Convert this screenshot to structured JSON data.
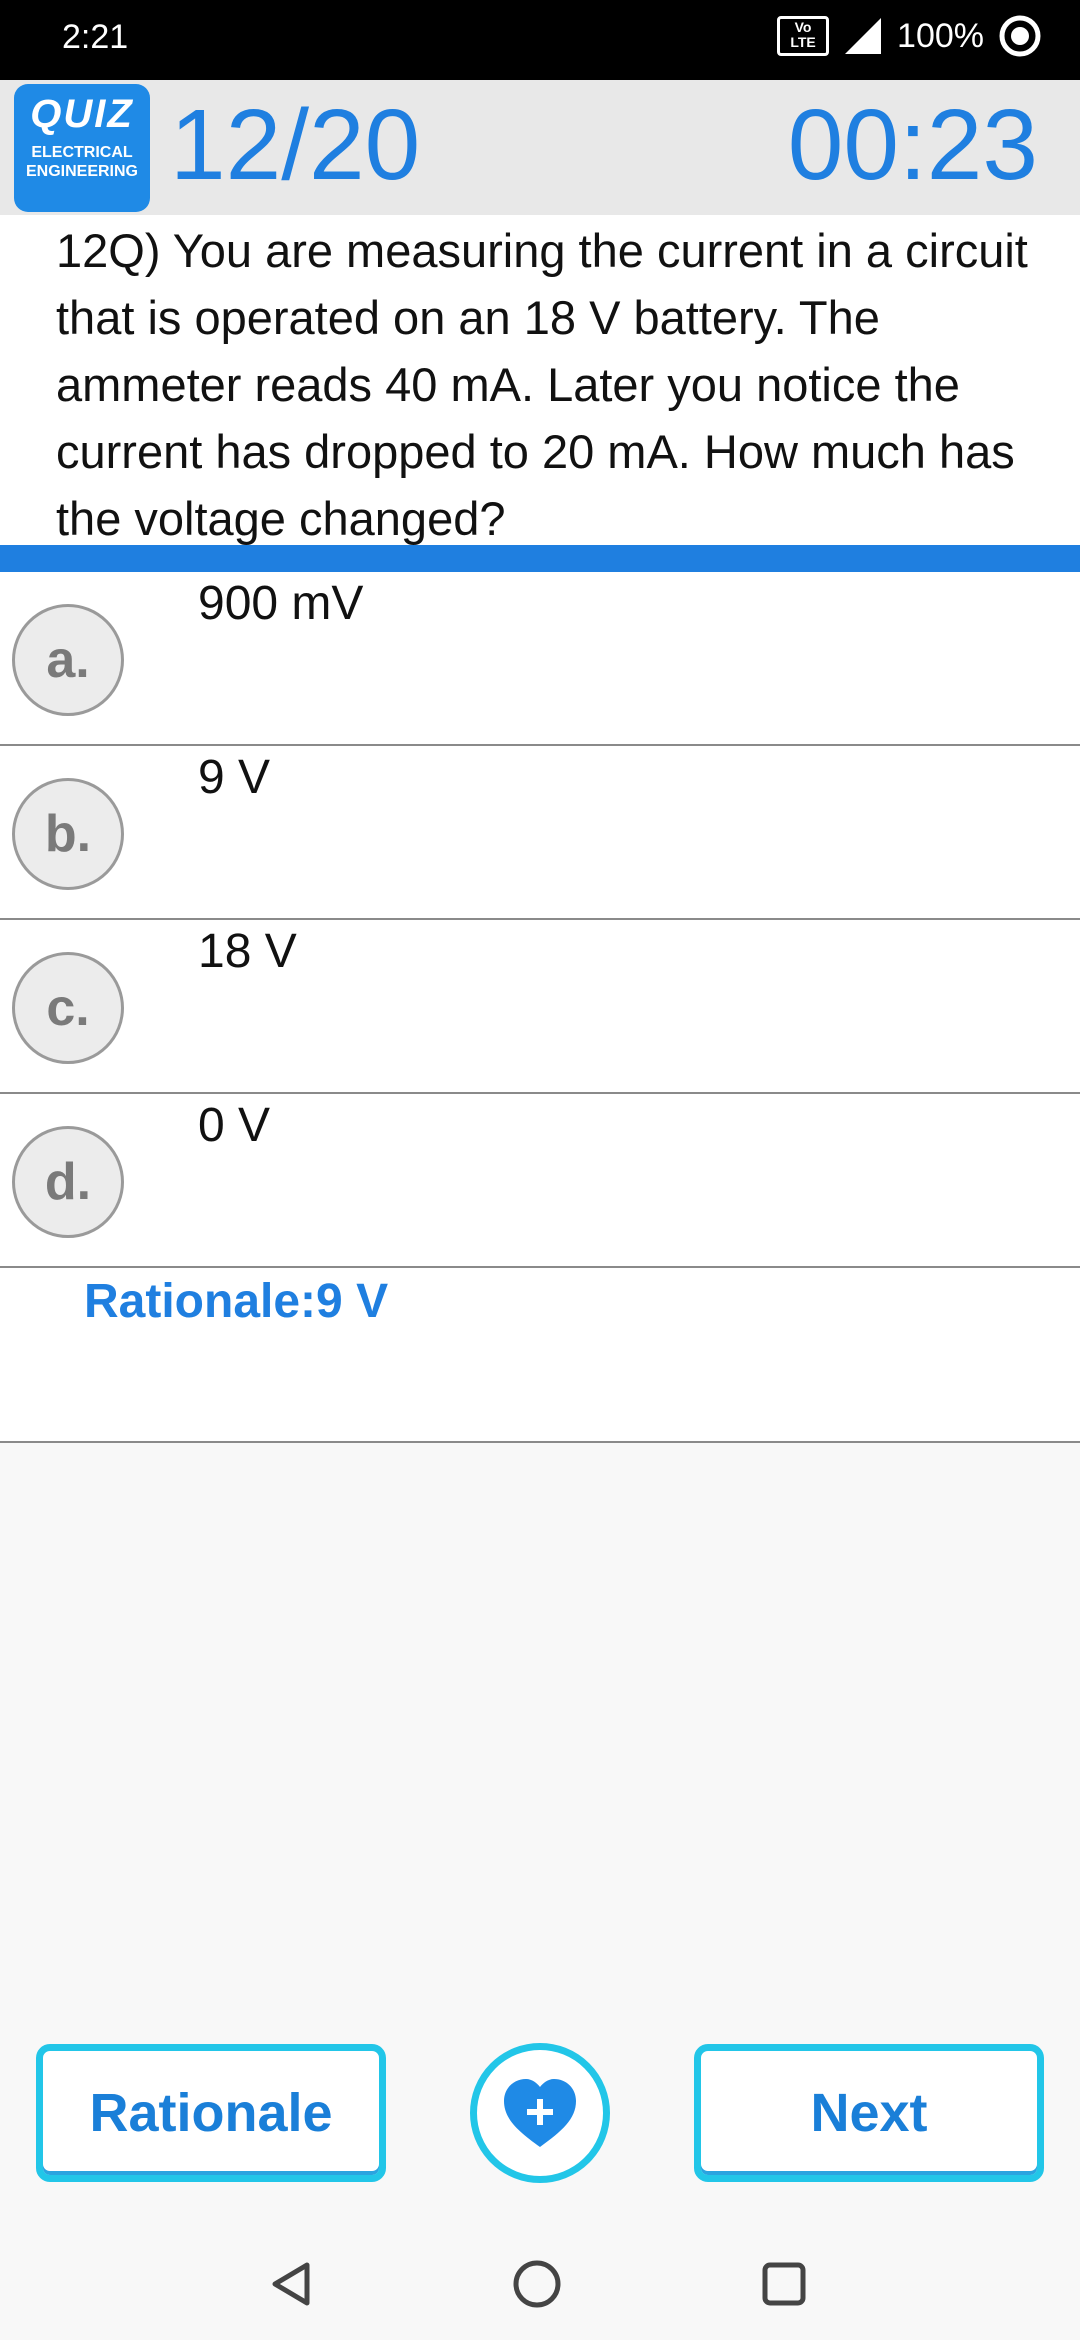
{
  "status_bar": {
    "time": "2:21",
    "volte_label": "Vo LTE 1",
    "battery": "100%"
  },
  "header": {
    "logo_title": "QUIZ",
    "logo_line1": "ELECTRICAL",
    "logo_line2": "ENGINEERING",
    "progress": "12/20",
    "timer": "00:23"
  },
  "question": {
    "text": "12Q) You are measuring the current in a circuit that is operated on an 18 V battery. The ammeter reads 40 mA. Later you notice the current has dropped to 20 mA. How much has the voltage changed?"
  },
  "options": [
    {
      "letter": "a.",
      "text": "900 mV"
    },
    {
      "letter": "b.",
      "text": "9 V"
    },
    {
      "letter": "c.",
      "text": "18 V"
    },
    {
      "letter": "d.",
      "text": "0 V"
    }
  ],
  "rationale": {
    "text": "Rationale:9 V"
  },
  "buttons": {
    "rationale_label": "Rationale",
    "next_label": "Next",
    "fav_icon": "heart-plus-icon"
  },
  "colors": {
    "accent": "#1f7fe0",
    "button_border": "#22c6e8"
  }
}
